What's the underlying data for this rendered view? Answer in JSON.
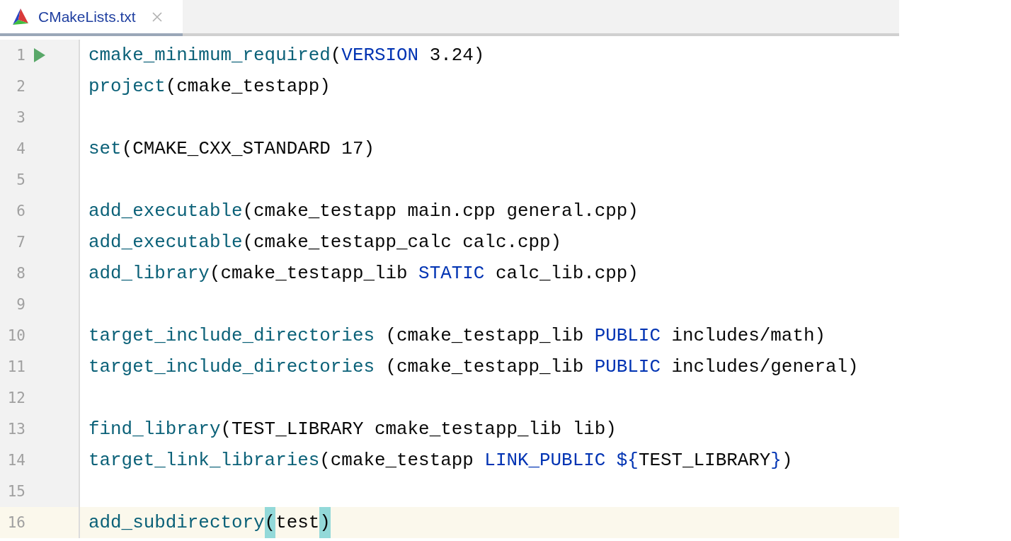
{
  "tabs": [
    {
      "label": "CMakeLists.txt",
      "selected": true
    }
  ],
  "editor": {
    "lines": [
      {
        "number": "1",
        "runnable": true,
        "current": false,
        "tokens": [
          {
            "kind": "func",
            "text": "cmake_minimum_required"
          },
          {
            "kind": "plain",
            "text": "("
          },
          {
            "kind": "keyword",
            "text": "VERSION"
          },
          {
            "kind": "plain",
            "text": " 3.24)"
          }
        ]
      },
      {
        "number": "2",
        "runnable": false,
        "current": false,
        "tokens": [
          {
            "kind": "func",
            "text": "project"
          },
          {
            "kind": "plain",
            "text": "(cmake_testapp)"
          }
        ]
      },
      {
        "number": "3",
        "runnable": false,
        "current": false
      },
      {
        "number": "4",
        "runnable": false,
        "current": false,
        "tokens": [
          {
            "kind": "func",
            "text": "set"
          },
          {
            "kind": "plain",
            "text": "(CMAKE_CXX_STANDARD 17)"
          }
        ]
      },
      {
        "number": "5",
        "runnable": false,
        "current": false
      },
      {
        "number": "6",
        "runnable": false,
        "current": false,
        "tokens": [
          {
            "kind": "func",
            "text": "add_executable"
          },
          {
            "kind": "plain",
            "text": "(cmake_testapp main.cpp general.cpp)"
          }
        ]
      },
      {
        "number": "7",
        "runnable": false,
        "current": false,
        "tokens": [
          {
            "kind": "func",
            "text": "add_executable"
          },
          {
            "kind": "plain",
            "text": "(cmake_testapp_calc calc.cpp)"
          }
        ]
      },
      {
        "number": "8",
        "runnable": false,
        "current": false,
        "tokens": [
          {
            "kind": "func",
            "text": "add_library"
          },
          {
            "kind": "plain",
            "text": "(cmake_testapp_lib "
          },
          {
            "kind": "keyword",
            "text": "STATIC"
          },
          {
            "kind": "plain",
            "text": " calc_lib.cpp)"
          }
        ]
      },
      {
        "number": "9",
        "runnable": false,
        "current": false
      },
      {
        "number": "10",
        "runnable": false,
        "current": false,
        "tokens": [
          {
            "kind": "func",
            "text": "target_include_directories"
          },
          {
            "kind": "plain",
            "text": " (cmake_testapp_lib "
          },
          {
            "kind": "keyword",
            "text": "PUBLIC"
          },
          {
            "kind": "plain",
            "text": " includes/math)"
          }
        ]
      },
      {
        "number": "11",
        "runnable": false,
        "current": false,
        "tokens": [
          {
            "kind": "func",
            "text": "target_include_directories"
          },
          {
            "kind": "plain",
            "text": " (cmake_testapp_lib "
          },
          {
            "kind": "keyword",
            "text": "PUBLIC"
          },
          {
            "kind": "plain",
            "text": " includes/general)"
          }
        ]
      },
      {
        "number": "12",
        "runnable": false,
        "current": false
      },
      {
        "number": "13",
        "runnable": false,
        "current": false,
        "tokens": [
          {
            "kind": "func",
            "text": "find_library"
          },
          {
            "kind": "plain",
            "text": "(TEST_LIBRARY cmake_testapp_lib lib)"
          }
        ]
      },
      {
        "number": "14",
        "runnable": false,
        "current": false,
        "tokens": [
          {
            "kind": "func",
            "text": "target_link_libraries"
          },
          {
            "kind": "plain",
            "text": "(cmake_testapp "
          },
          {
            "kind": "keyword",
            "text": "LINK_PUBLIC ${"
          },
          {
            "kind": "plain",
            "text": "TEST_LIBRARY"
          },
          {
            "kind": "keyword",
            "text": "}"
          },
          {
            "kind": "plain",
            "text": ")"
          }
        ]
      },
      {
        "number": "15",
        "runnable": false,
        "current": false
      },
      {
        "number": "16",
        "runnable": false,
        "current": true,
        "tokens": [
          {
            "kind": "func",
            "text": "add_subdirectory"
          },
          {
            "kind": "matched-paren",
            "text": "("
          },
          {
            "kind": "plain",
            "text": "test"
          },
          {
            "kind": "matched-paren",
            "text": ")"
          }
        ]
      }
    ]
  }
}
